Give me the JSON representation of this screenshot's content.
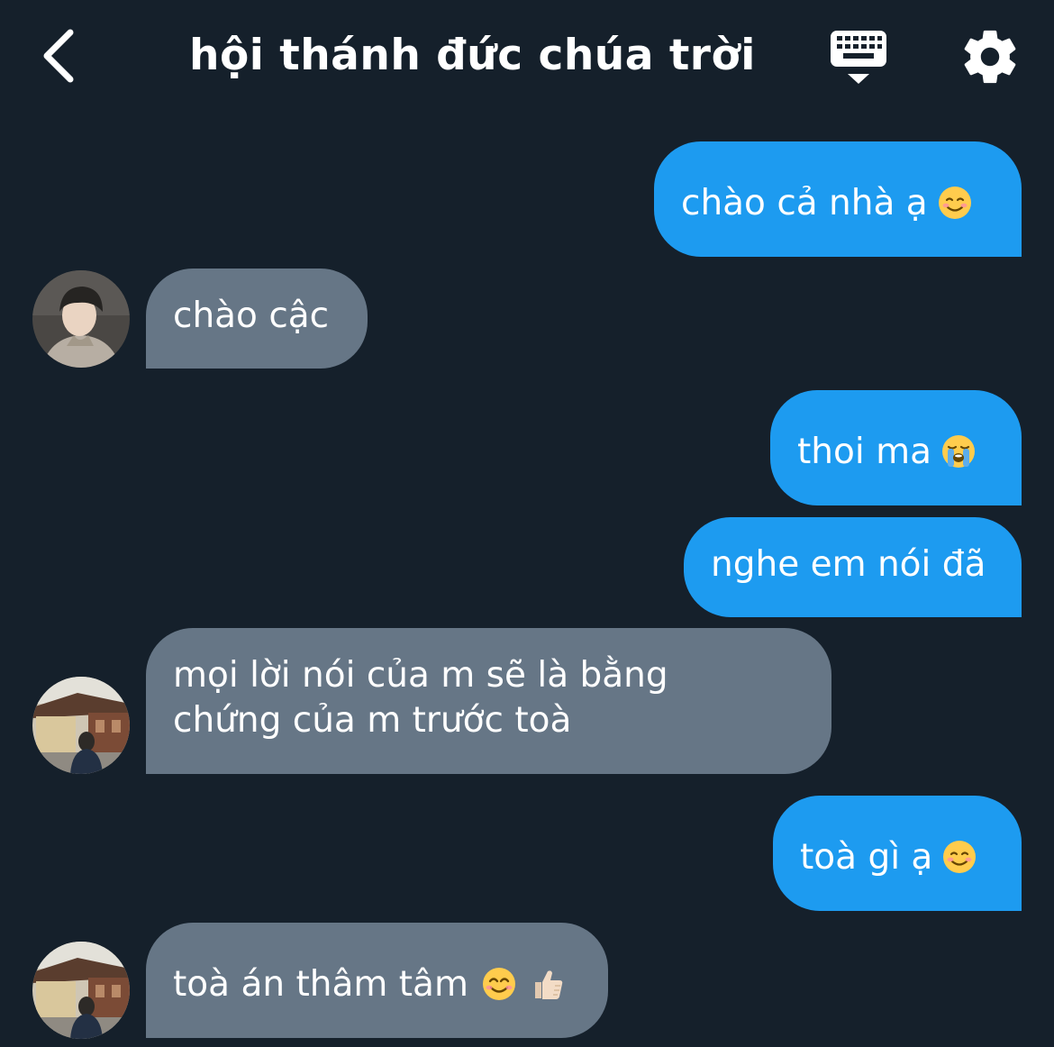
{
  "header": {
    "title": "hội thánh đức chúa trời",
    "back_icon": "chevron-left-icon",
    "keyboard_icon": "keyboard-icon",
    "settings_icon": "gear-icon"
  },
  "colors": {
    "background": "#15202b",
    "sent_bubble": "#1d9bf0",
    "received_bubble": "#667686",
    "text": "#ffffff"
  },
  "messages": [
    {
      "direction": "sent",
      "text": "chào cả nhà ạ",
      "emoji": "smiling-face-icon"
    },
    {
      "direction": "received",
      "text": "chào cậc"
    },
    {
      "direction": "sent",
      "text": "thoi ma",
      "emoji": "loudly-crying-face-icon"
    },
    {
      "direction": "sent",
      "text": "nghe em nói đã"
    },
    {
      "direction": "received",
      "line1": "mọi lời nói của m sẽ là bằng",
      "line2": "chứng của m trước toà"
    },
    {
      "direction": "sent",
      "text": "toà gì ạ",
      "emoji": "smiling-face-icon"
    },
    {
      "direction": "received",
      "text": "toà án thâm tâm",
      "emoji": "smiling-eyes-face-icon",
      "emoji2": "thumbs-up-icon"
    }
  ]
}
